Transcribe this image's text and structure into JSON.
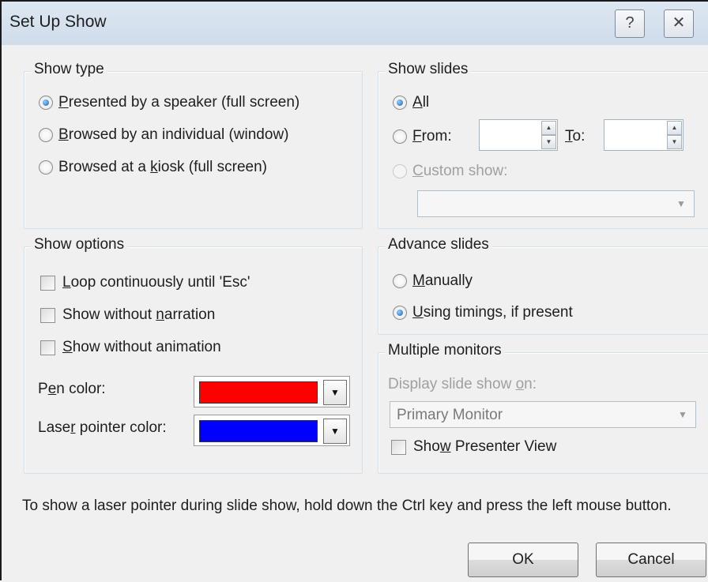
{
  "window": {
    "title": "Set Up Show",
    "help_glyph": "?",
    "close_glyph": "✕"
  },
  "show_type": {
    "label": "Show type",
    "options": [
      {
        "pre": "",
        "u": "P",
        "post": "resented by a speaker (full screen)",
        "selected": true
      },
      {
        "pre": "",
        "u": "B",
        "post": "rowsed by an individual (window)",
        "selected": false
      },
      {
        "pre": "Browsed at a ",
        "u": "k",
        "post": "iosk (full screen)",
        "selected": false
      }
    ]
  },
  "show_slides": {
    "label": "Show slides",
    "all": {
      "pre": "",
      "u": "A",
      "post": "ll",
      "selected": true
    },
    "from": {
      "pre": "",
      "u": "F",
      "post": "rom:",
      "value": ""
    },
    "to": {
      "pre": "",
      "u": "T",
      "post": "o:",
      "value": ""
    },
    "custom": {
      "pre": "",
      "u": "C",
      "post": "ustom show:",
      "disabled": true
    },
    "custom_value": ""
  },
  "show_options": {
    "label": "Show options",
    "checks": [
      {
        "pre": "",
        "u": "L",
        "post": "oop continuously until 'Esc'",
        "checked": false
      },
      {
        "pre": "Show without ",
        "u": "n",
        "post": "arration",
        "checked": false
      },
      {
        "pre": "",
        "u": "S",
        "post": "how without animation",
        "checked": false
      }
    ],
    "pen": {
      "pre": "P",
      "u": "e",
      "post": "n color:",
      "color": "#ff0000"
    },
    "laser": {
      "pre": "Lase",
      "u": "r",
      "post": " pointer color:",
      "color": "#0000ff"
    }
  },
  "advance_slides": {
    "label": "Advance slides",
    "options": [
      {
        "pre": "",
        "u": "M",
        "post": "anually",
        "selected": false
      },
      {
        "pre": "",
        "u": "U",
        "post": "sing timings, if present",
        "selected": true
      }
    ]
  },
  "monitors": {
    "label": "Multiple monitors",
    "display_label": {
      "pre": "Display slide show ",
      "u": "o",
      "post": "n:"
    },
    "display_value": "Primary Monitor",
    "presenter": {
      "pre": "Sho",
      "u": "w",
      "post": " Presenter View",
      "checked": false
    }
  },
  "info_text": "To show a laser pointer during slide show, hold down the Ctrl key and press the left mouse button.",
  "buttons": {
    "ok": "OK",
    "cancel": "Cancel"
  },
  "icons": {
    "dropdown": "▼",
    "spin_up": "▲",
    "spin_down": "▼"
  }
}
